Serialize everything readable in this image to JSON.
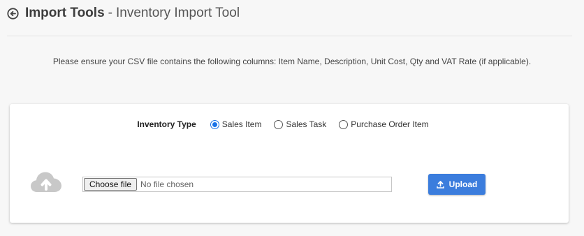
{
  "header": {
    "title": "Import Tools",
    "separator": "-",
    "subtitle": "Inventory Import Tool",
    "back_icon": "circle-arrow-left-icon"
  },
  "notice": "Please ensure your CSV file contains the following columns: Item Name, Description, Unit Cost, Qty and VAT Rate (if applicable).",
  "inventory_type": {
    "label": "Inventory Type",
    "options": [
      {
        "label": "Sales Item",
        "checked": true
      },
      {
        "label": "Sales Task",
        "checked": false
      },
      {
        "label": "Purchase Order Item",
        "checked": false
      }
    ]
  },
  "file": {
    "choose_label": "Choose file",
    "status": "No file chosen"
  },
  "upload": {
    "label": "Upload",
    "icon": "upload-icon"
  },
  "colors": {
    "accent": "#3b7ddd",
    "radio_selected": "#1a73e8",
    "cloud": "#c8c8c8"
  }
}
